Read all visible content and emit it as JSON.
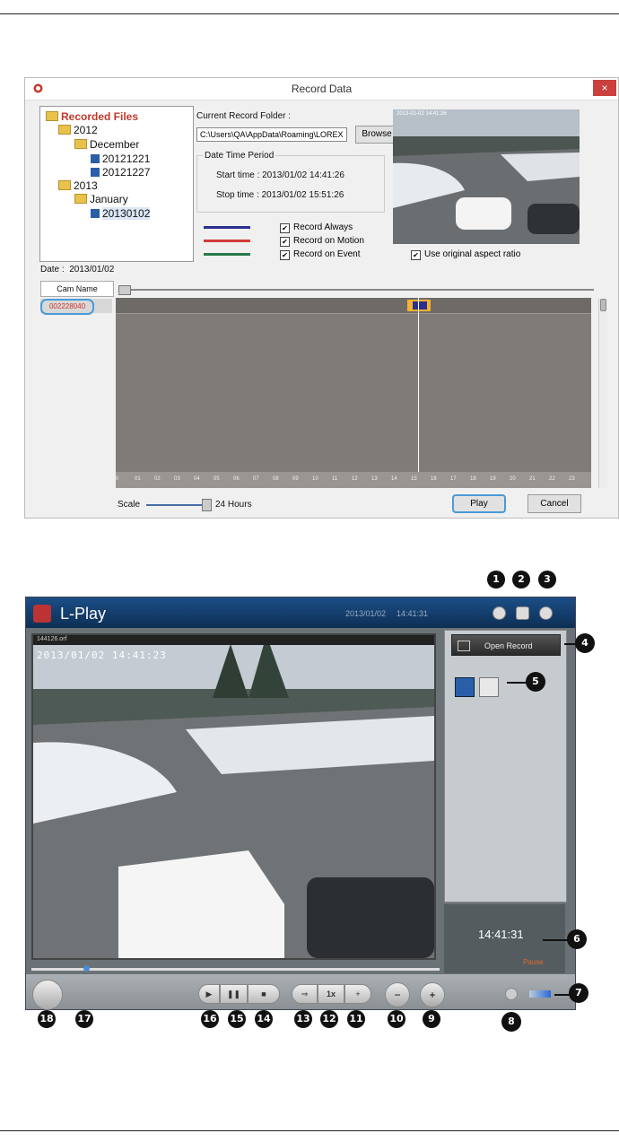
{
  "record_data": {
    "title": "Record Data",
    "close_label": "×",
    "tree": {
      "root": "Recorded Files",
      "nodes": [
        {
          "label": "2012",
          "kind": "folder"
        },
        {
          "label": "December",
          "kind": "folder"
        },
        {
          "label": "20121221",
          "kind": "file"
        },
        {
          "label": "20121227",
          "kind": "file"
        },
        {
          "label": "2013",
          "kind": "folder"
        },
        {
          "label": "January",
          "kind": "folder"
        },
        {
          "label": "20130102",
          "kind": "file",
          "selected": true
        }
      ]
    },
    "current_folder_label": "Current Record Folder :",
    "current_folder_value": "C:\\Users\\QA\\AppData\\Roaming\\LOREX",
    "browse_label": "Browse",
    "date_time_period_label": "Date Time Period",
    "start_time": "Start time : 2013/01/02 14:41:26",
    "stop_time": "Stop time : 2013/01/02 15:51:26",
    "legend": [
      {
        "label": "Record Always",
        "color": "#2c2f8f",
        "checked": true
      },
      {
        "label": "Record on Motion",
        "color": "#d23a3a",
        "checked": true
      },
      {
        "label": "Record on Event",
        "color": "#2a7a4a",
        "checked": true
      }
    ],
    "aspect_ratio_label": "Use original aspect ratio",
    "date_label": "Date :",
    "date_value": "2013/01/02",
    "cam_name_header": "Cam Name",
    "cam_row": "002228040",
    "hours": [
      "0",
      "01",
      "02",
      "03",
      "04",
      "05",
      "06",
      "07",
      "08",
      "09",
      "10",
      "11",
      "12",
      "13",
      "14",
      "15",
      "16",
      "17",
      "18",
      "19",
      "20",
      "21",
      "22",
      "23"
    ],
    "scale_label": "Scale",
    "scale_value": "24 Hours",
    "play_label": "Play",
    "cancel_label": "Cancel",
    "camera_overlay": "2013-01-02 14:41:26"
  },
  "lplay": {
    "title": "L-Play",
    "header_date": "2013/01/02",
    "header_time": "14:41:31",
    "video_filename": "144126.orf",
    "video_timestamp": "2013/01/02 14:41:23",
    "open_record_label": "Open Record",
    "clock": "14:41:31",
    "state": "Pause",
    "speed_label": "1x",
    "colors": {
      "titlebar": "#1b4e86",
      "pause_text": "#e46a2a"
    }
  },
  "callouts": [
    "1",
    "2",
    "3",
    "4",
    "5",
    "6",
    "7",
    "8",
    "9",
    "10",
    "11",
    "12",
    "13",
    "14",
    "15",
    "16",
    "17",
    "18"
  ]
}
